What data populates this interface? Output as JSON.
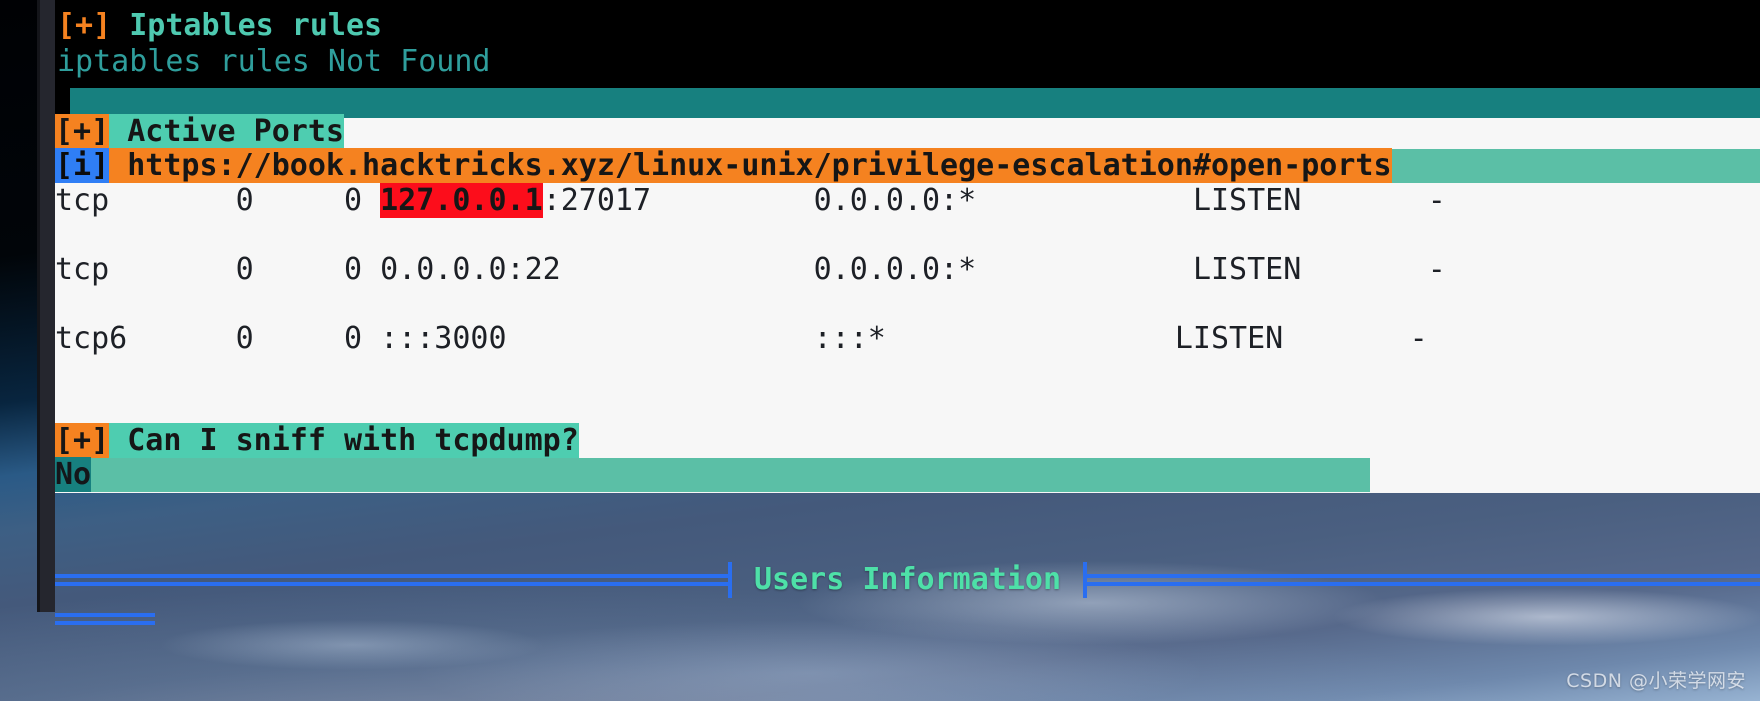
{
  "terminal": {
    "sections": {
      "iptables": {
        "tag": "[+]",
        "title": " Iptables rules",
        "message": "iptables rules Not Found"
      },
      "active_ports": {
        "tag": "[+]",
        "title": " Active Ports",
        "info_tag": "[i]",
        "url": " https://book.hacktricks.xyz/linux-unix/privilege-escalation#open-ports",
        "rows": [
          {
            "proto": "tcp",
            "recvq": "0",
            "sendq": "0",
            "local_highlight": "127.0.0.1",
            "local_rest": ":27017",
            "foreign": "0.0.0.0:*",
            "state": "LISTEN",
            "pid": "-"
          },
          {
            "proto": "tcp",
            "recvq": "0",
            "sendq": "0",
            "local_highlight": "",
            "local_rest": "0.0.0.0:22",
            "foreign": "0.0.0.0:*",
            "state": "LISTEN",
            "pid": "-"
          },
          {
            "proto": "tcp6",
            "recvq": "0",
            "sendq": "0",
            "local_highlight": "",
            "local_rest": ":::3000",
            "foreign": ":::*",
            "state": "LISTEN",
            "pid": "-"
          }
        ]
      },
      "tcpdump": {
        "tag": "[+]",
        "title": " Can I sniff with tcpdump?",
        "answer": "No"
      }
    }
  },
  "desktop": {
    "users_section_title": "Users Information",
    "watermark": "CSDN @小荣学网安"
  },
  "colors": {
    "tag_orange": "#f58220",
    "header_teal": "#4ec9b0",
    "body_teal": "#2f9e9c",
    "band_teal_dark": "#17807f",
    "band_teal_light": "#5bbfa6",
    "highlight_mint": "#4ecdb0",
    "highlight_blue": "#2f7ef5",
    "highlight_red": "#fc0d1b",
    "paper": "#f7f7f7",
    "terminal_bg": "#000000",
    "separator_blue": "#2a6ef0",
    "users_title_green": "#4ee0a8"
  }
}
